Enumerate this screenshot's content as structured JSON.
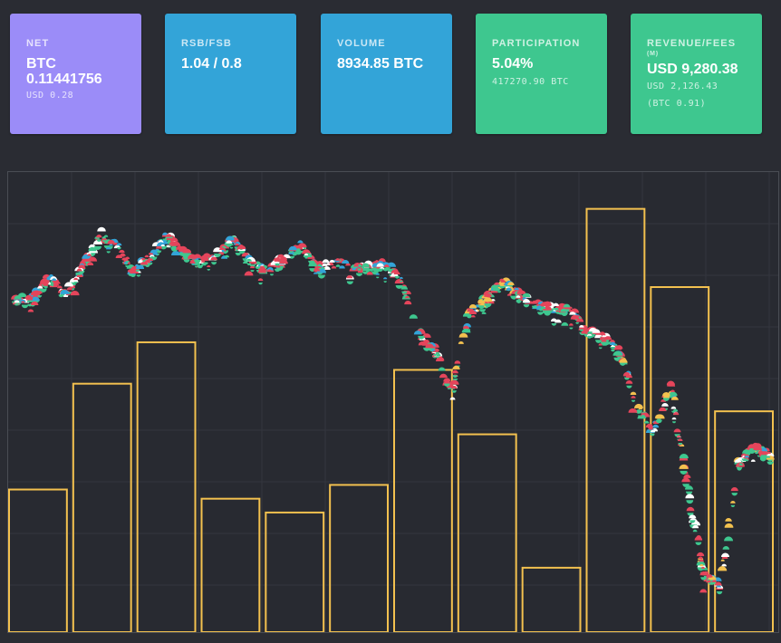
{
  "cards": [
    {
      "label": "NET",
      "main_line1": "BTC",
      "main_line2": "0.11441756",
      "sub": "USD 0.28",
      "color": "#9b8cf8"
    },
    {
      "label": "RSB/FSB",
      "main": "1.04 / 0.8",
      "color": "#33a4d8"
    },
    {
      "label": "VOLUME",
      "main": "8934.85 BTC",
      "color": "#33a4d8"
    },
    {
      "label": "PARTICIPATION",
      "main": "5.04%",
      "sub": "417270.90 BTC",
      "color": "#3ec78f"
    },
    {
      "label": "REVENUE/FEES",
      "sup": "(M)",
      "main": "USD 9,280.38",
      "sub": "USD 2,126.43",
      "sub2": "(BTC 0.91)",
      "color": "#3ec78f"
    }
  ],
  "colors": {
    "background": "#2a2c33",
    "bar_outline": "#f3c14f",
    "dot_red": "#e5455b",
    "dot_green": "#3ec78f",
    "dot_blue": "#33a4d8",
    "dot_yellow": "#f3c14f",
    "dot_white": "#ffffff"
  },
  "chart_data": {
    "type": "bar",
    "overlay": "scatter",
    "grid": true,
    "bars": {
      "values": [
        31,
        54,
        63,
        29,
        26,
        32,
        57,
        43,
        14,
        92,
        75,
        48
      ]
    },
    "price_series": {
      "values": [
        72,
        72,
        77,
        73,
        79,
        86,
        84,
        78,
        81,
        86,
        82,
        80,
        82,
        85,
        80,
        78,
        81,
        84,
        79,
        80,
        79,
        79,
        80,
        76,
        65,
        61,
        52,
        69,
        72,
        76,
        73,
        71,
        70,
        70,
        65,
        64,
        61,
        49,
        43,
        54,
        33,
        12,
        10,
        36,
        40,
        38
      ]
    }
  }
}
